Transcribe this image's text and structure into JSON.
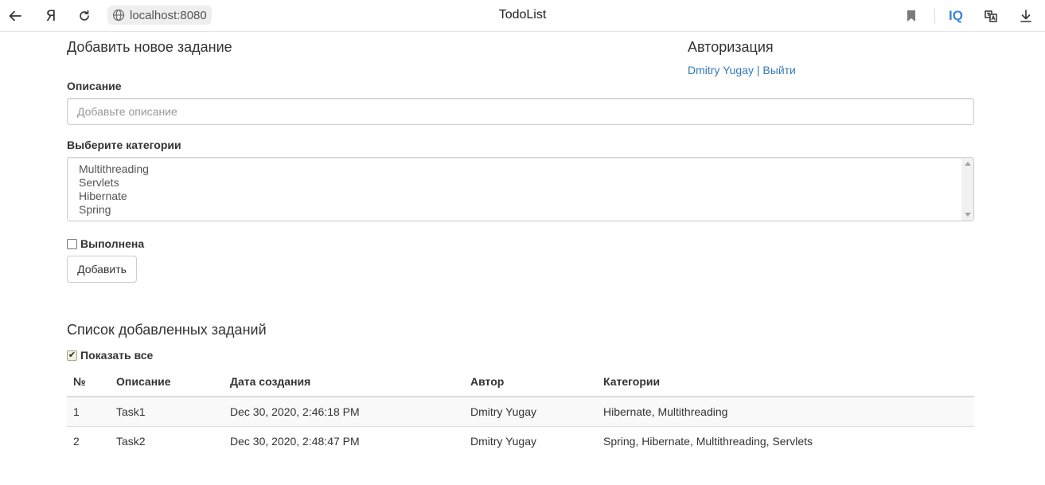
{
  "browser": {
    "ya_glyph": "Я",
    "address": "localhost:8080",
    "title": "TodoList",
    "iq_label": "IQ"
  },
  "add_form": {
    "title": "Добавить новое задание",
    "description_label": "Описание",
    "description_placeholder": "Добавьте описание",
    "categories_label": "Выберите категории",
    "categories": [
      "Multithreading",
      "Servlets",
      "Hibernate",
      "Spring"
    ],
    "done_label": "Выполнена",
    "done_checked": false,
    "add_button": "Добавить"
  },
  "auth": {
    "title": "Авторизация",
    "user_name": "Dmitry Yugay",
    "separator": " | ",
    "logout": "Выйти"
  },
  "tasks": {
    "title": "Список добавленных заданий",
    "show_all_label": "Показать все",
    "show_all_checked": true,
    "columns": [
      "№",
      "Описание",
      "Дата создания",
      "Автор",
      "Категории"
    ],
    "rows": [
      [
        "1",
        "Task1",
        "Dec 30, 2020, 2:46:18 PM",
        "Dmitry Yugay",
        "Hibernate, Multithreading"
      ],
      [
        "2",
        "Task2",
        "Dec 30, 2020, 2:48:47 PM",
        "Dmitry Yugay",
        "Spring, Hibernate, Multithreading, Servlets"
      ]
    ]
  },
  "colors": {
    "link": "#337ab7",
    "text": "#333333",
    "border": "#cccccc"
  }
}
